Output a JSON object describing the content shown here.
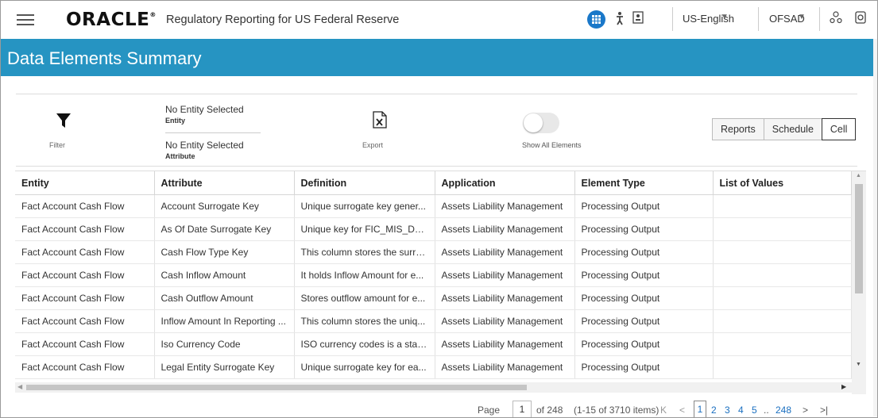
{
  "header": {
    "brand": "ORACLE",
    "brand_mark": "®",
    "product": "Regulatory Reporting for US Federal Reserve",
    "language": "US-English",
    "user": "OFSAD",
    "icons": [
      "menu-icon",
      "apps-grid-icon",
      "accessibility-icon",
      "profile-card-icon",
      "org-chart-icon",
      "logout-icon"
    ]
  },
  "page": {
    "title": "Data Elements Summary"
  },
  "toolbar": {
    "filter_label": "Filter",
    "entity_value": "No Entity Selected",
    "entity_label": "Entity",
    "attribute_value": "No Entity Selected",
    "attribute_label": "Attribute",
    "export_label": "Export",
    "show_all_label": "Show All Elements",
    "show_all_on": false,
    "view_buttons": [
      "Reports",
      "Schedule",
      "Cell"
    ],
    "active_view": "Cell"
  },
  "table": {
    "columns": [
      "Entity",
      "Attribute",
      "Definition",
      "Application",
      "Element Type",
      "List of Values"
    ],
    "rows": [
      [
        "Fact Account Cash Flow",
        "Account Surrogate Key",
        "Unique surrogate key gener...",
        "Assets Liability Management",
        "Processing Output",
        ""
      ],
      [
        "Fact Account Cash Flow",
        "As Of Date Surrogate Key",
        "Unique key for FIC_MIS_Dat...",
        "Assets Liability Management",
        "Processing Output",
        ""
      ],
      [
        "Fact Account Cash Flow",
        "Cash Flow Type Key",
        "This column stores the surro...",
        "Assets Liability Management",
        "Processing Output",
        ""
      ],
      [
        "Fact Account Cash Flow",
        "Cash Inflow Amount",
        "It holds Inflow Amount for e...",
        "Assets Liability Management",
        "Processing Output",
        ""
      ],
      [
        "Fact Account Cash Flow",
        "Cash Outflow Amount",
        "Stores outflow amount for e...",
        "Assets Liability Management",
        "Processing Output",
        ""
      ],
      [
        "Fact Account Cash Flow",
        "Inflow Amount In Reporting ...",
        "This column stores the uniq...",
        "Assets Liability Management",
        "Processing Output",
        ""
      ],
      [
        "Fact Account Cash Flow",
        "Iso Currency Code",
        "ISO currency codes is a stan...",
        "Assets Liability Management",
        "Processing Output",
        ""
      ],
      [
        "Fact Account Cash Flow",
        "Legal Entity Surrogate Key",
        "Unique surrogate key for ea...",
        "Assets Liability Management",
        "Processing Output",
        ""
      ]
    ]
  },
  "pagination": {
    "page_label": "Page",
    "current_page": "1",
    "of_text": "of 248",
    "range_text": "(1-15 of 3710 items)",
    "pages": [
      "1",
      "2",
      "3",
      "4",
      "5"
    ],
    "ellipsis": "..",
    "last_page": "248"
  }
}
